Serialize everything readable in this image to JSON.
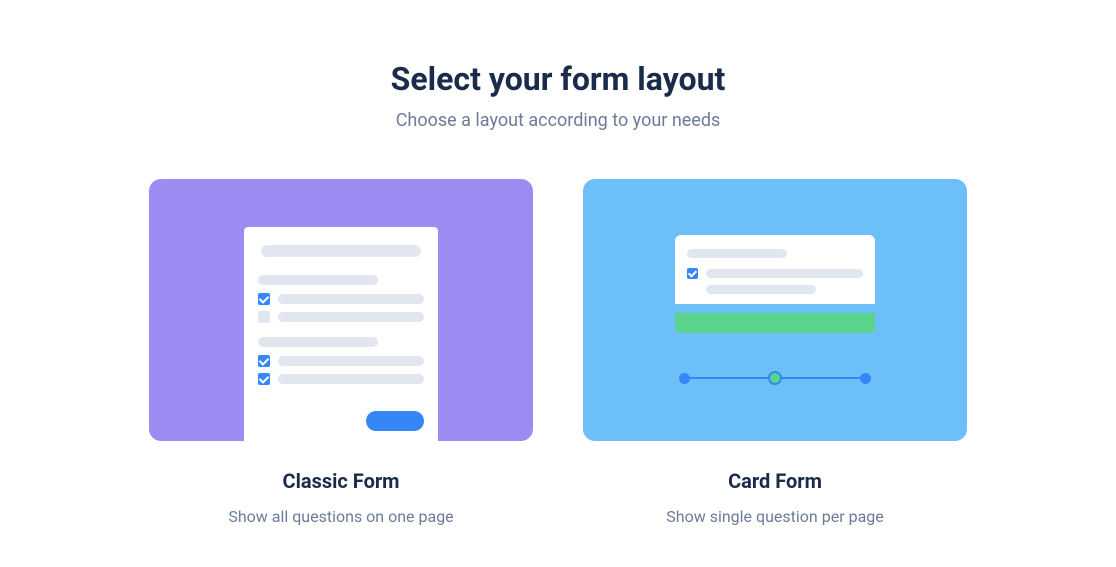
{
  "header": {
    "title": "Select your form layout",
    "subtitle": "Choose a layout according to your needs"
  },
  "options": [
    {
      "id": "classic",
      "title": "Classic Form",
      "description": "Show all questions on one page"
    },
    {
      "id": "card",
      "title": "Card Form",
      "description": "Show single question per page"
    }
  ]
}
